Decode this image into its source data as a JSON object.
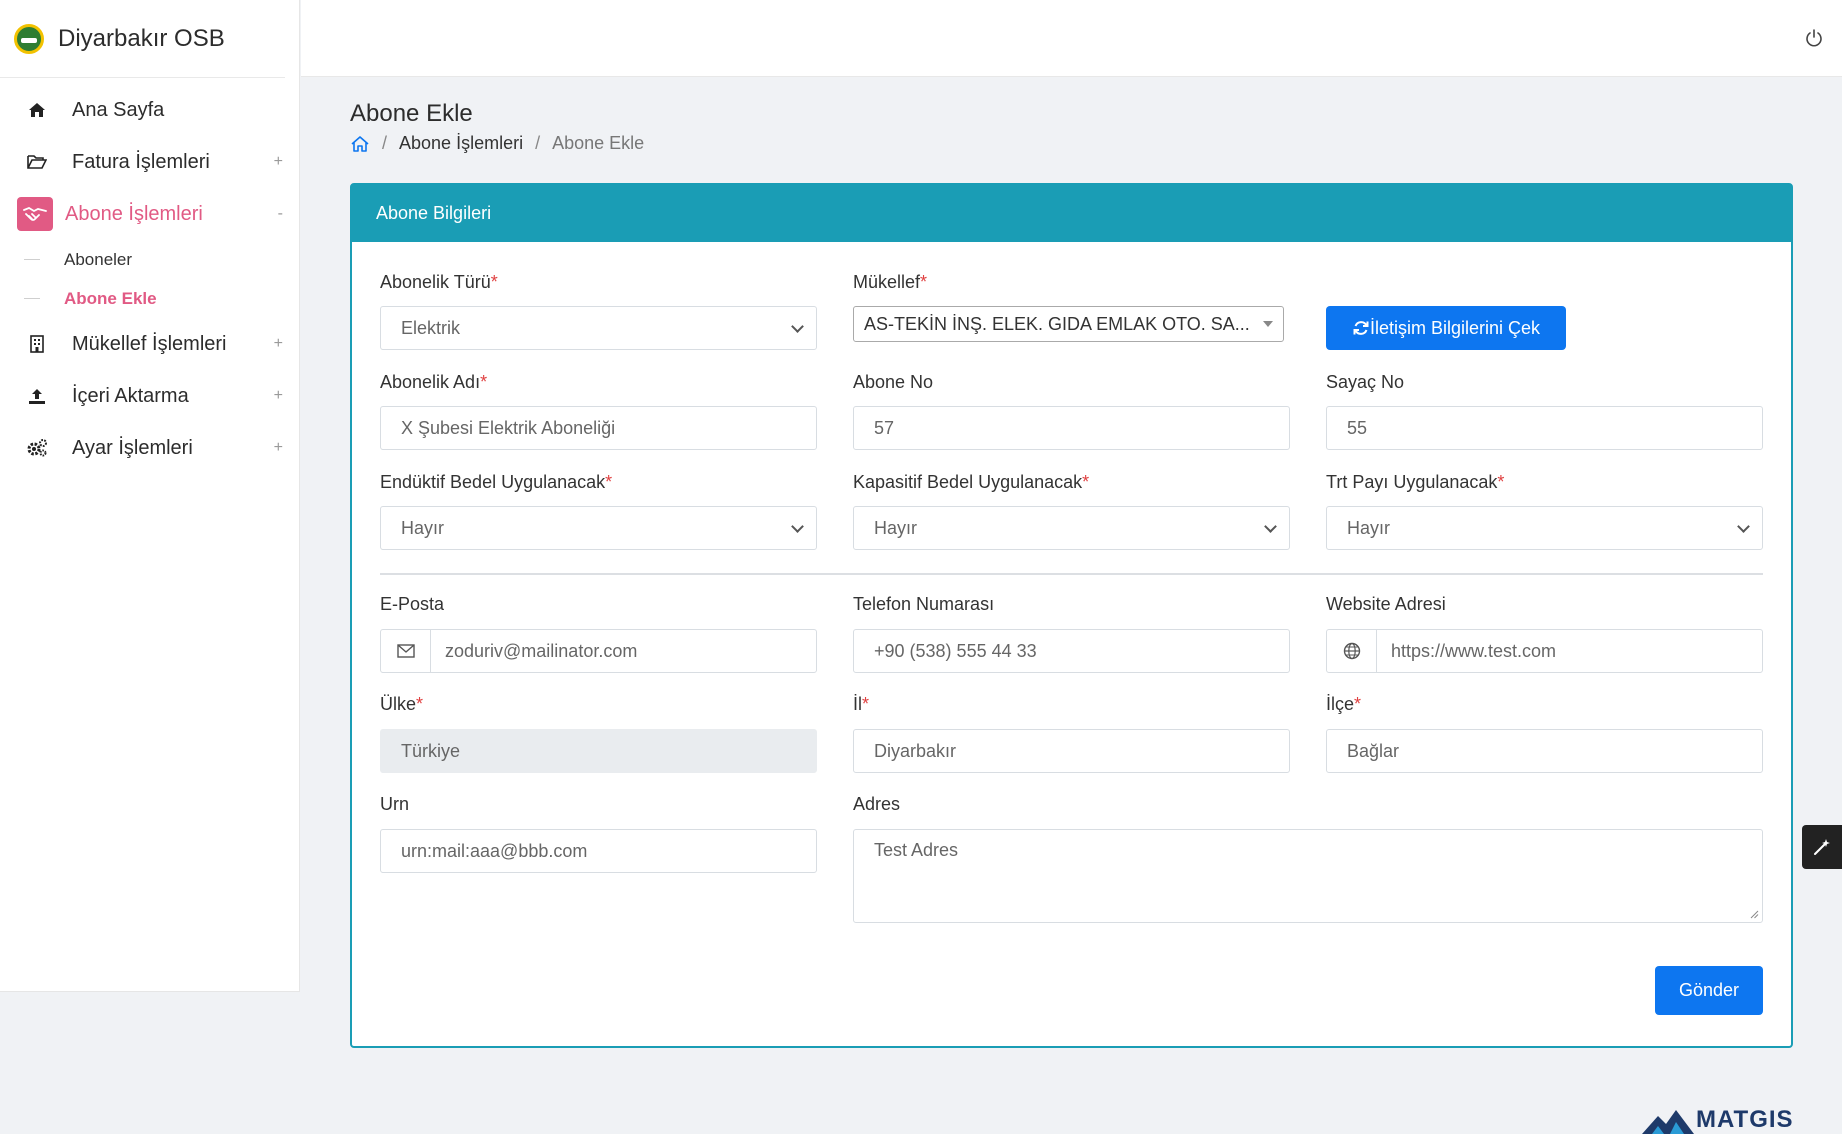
{
  "brand": {
    "name": "Diyarbakır OSB"
  },
  "sidebar": {
    "items": [
      {
        "label": "Ana Sayfa",
        "icon": "home-icon",
        "toggle": ""
      },
      {
        "label": "Fatura İşlemleri",
        "icon": "folder-open-icon",
        "toggle": "+"
      },
      {
        "label": "Abone İşlemleri",
        "icon": "handshake-icon",
        "toggle": "-"
      },
      {
        "label": "Mükellef İşlemleri",
        "icon": "building-icon",
        "toggle": "+"
      },
      {
        "label": "İçeri Aktarma",
        "icon": "upload-icon",
        "toggle": "+"
      },
      {
        "label": "Ayar İşlemleri",
        "icon": "gears-icon",
        "toggle": "+"
      }
    ],
    "submenu": [
      {
        "label": "Aboneler"
      },
      {
        "label": "Abone Ekle"
      }
    ]
  },
  "page": {
    "title": "Abone Ekle",
    "breadcrumb": {
      "parent": "Abone İşlemleri",
      "current": "Abone Ekle",
      "separator": "/"
    }
  },
  "card": {
    "header": "Abone Bilgileri",
    "required_mark": "*",
    "fields": {
      "abonelik_turu": {
        "label": "Abonelik Türü",
        "value": "Elektrik"
      },
      "mukellef": {
        "label": "Mükellef",
        "value": "AS-TEKİN İNŞ. ELEK. GIDA EMLAK OTO. SA..."
      },
      "fetch_button": {
        "label": "İletişim Bilgilerini Çek"
      },
      "abonelik_adi": {
        "label": "Abonelik Adı",
        "value": "X Şubesi Elektrik Aboneliği"
      },
      "abone_no": {
        "label": "Abone No",
        "value": "57"
      },
      "sayac_no": {
        "label": "Sayaç No",
        "value": "55"
      },
      "enduktif": {
        "label": "Endüktif Bedel Uygulanacak",
        "value": "Hayır"
      },
      "kapasitif": {
        "label": "Kapasitif Bedel Uygulanacak",
        "value": "Hayır"
      },
      "trt": {
        "label": "Trt Payı Uygulanacak",
        "value": "Hayır"
      },
      "eposta": {
        "label": "E-Posta",
        "value": "zoduriv@mailinator.com"
      },
      "telefon": {
        "label": "Telefon Numarası",
        "value": "+90 (538) 555 44 33"
      },
      "website": {
        "label": "Website Adresi",
        "value": "https://www.test.com"
      },
      "ulke": {
        "label": "Ülke",
        "value": "Türkiye"
      },
      "il": {
        "label": "İl",
        "value": "Diyarbakır"
      },
      "ilce": {
        "label": "İlçe",
        "value": "Bağlar"
      },
      "urn": {
        "label": "Urn",
        "value": "urn:mail:aaa@bbb.com"
      },
      "adres": {
        "label": "Adres",
        "value": "Test Adres"
      }
    },
    "submit_label": "Gönder"
  },
  "footer": {
    "logo_text": "MATGIS"
  },
  "colors": {
    "accent": "#1a9db5",
    "active": "#e15a84",
    "primary_button": "#0d76f0"
  }
}
